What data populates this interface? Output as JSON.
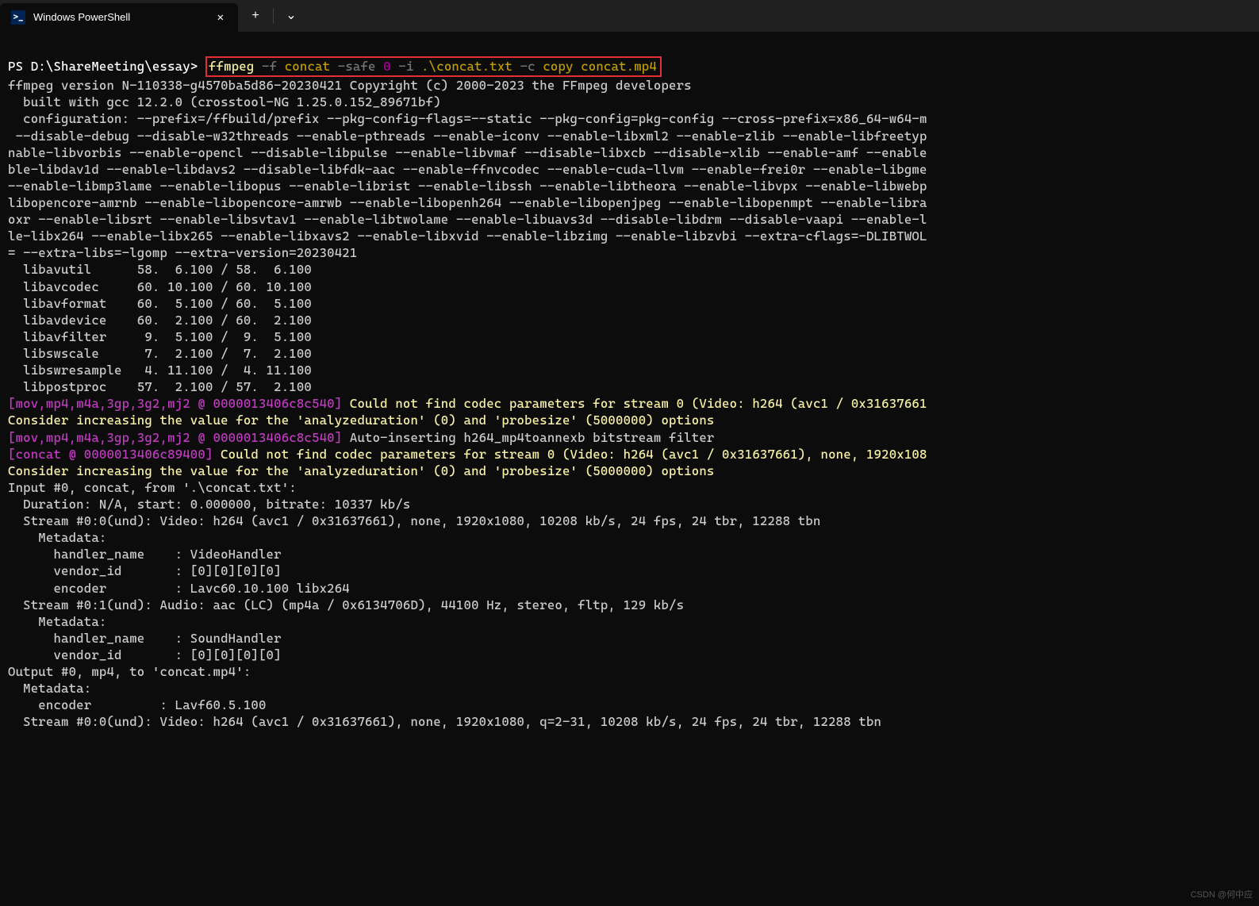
{
  "titlebar": {
    "tab_icon_glyph": ">_",
    "tab_title": "Windows PowerShell",
    "tab_close": "✕",
    "new_tab": "+",
    "dropdown": "⌄"
  },
  "prompt": {
    "ps_prefix": "PS ",
    "path": "D:\\ShareMeeting\\essay",
    "gt": "> "
  },
  "command": {
    "exe": "ffmpeg",
    "flag_f": " -f",
    "arg_concat": " concat",
    "flag_safe": " -safe",
    "arg_zero": " 0",
    "flag_i": " -i",
    "arg_input": " .\\concat.txt",
    "flag_c": " -c",
    "arg_copy": " copy",
    "arg_out": " concat.mp4"
  },
  "banner": [
    "ffmpeg version N-110338-g4570ba5d86-20230421 Copyright (c) 2000-2023 the FFmpeg developers",
    "  built with gcc 12.2.0 (crosstool-NG 1.25.0.152_89671bf)",
    "  configuration: --prefix=/ffbuild/prefix --pkg-config-flags=--static --pkg-config=pkg-config --cross-prefix=x86_64-w64-m",
    " --disable-debug --disable-w32threads --enable-pthreads --enable-iconv --enable-libxml2 --enable-zlib --enable-libfreetyp",
    "nable-libvorbis --enable-opencl --disable-libpulse --enable-libvmaf --disable-libxcb --disable-xlib --enable-amf --enable",
    "ble-libdav1d --enable-libdavs2 --disable-libfdk-aac --enable-ffnvcodec --enable-cuda-llvm --enable-frei0r --enable-libgme",
    "--enable-libmp3lame --enable-libopus --enable-librist --enable-libssh --enable-libtheora --enable-libvpx --enable-libwebp",
    "libopencore-amrnb --enable-libopencore-amrwb --enable-libopenh264 --enable-libopenjpeg --enable-libopenmpt --enable-libra",
    "oxr --enable-libsrt --enable-libsvtav1 --enable-libtwolame --enable-libuavs3d --disable-libdrm --disable-vaapi --enable-l",
    "le-libx264 --enable-libx265 --enable-libxavs2 --enable-libxvid --enable-libzimg --enable-libzvbi --extra-cflags=-DLIBTWOL",
    "= --extra-libs=-lgomp --extra-version=20230421"
  ],
  "libs": [
    "  libavutil      58.  6.100 / 58.  6.100",
    "  libavcodec     60. 10.100 / 60. 10.100",
    "  libavformat    60.  5.100 / 60.  5.100",
    "  libavdevice    60.  2.100 / 60.  2.100",
    "  libavfilter     9.  5.100 /  9.  5.100",
    "  libswscale      7.  2.100 /  7.  2.100",
    "  libswresample   4. 11.100 /  4. 11.100",
    "  libpostproc    57.  2.100 / 57.  2.100"
  ],
  "warn1": {
    "tag": "[mov,mp4,m4a,3gp,3g2,mj2 @ 0000013406c8c540] ",
    "msg": "Could not find codec parameters for stream 0 (Video: h264 (avc1 / 0x31637661",
    "cont": "Consider increasing the value for the 'analyzeduration' (0) and 'probesize' (5000000) options"
  },
  "info1": {
    "tag": "[mov,mp4,m4a,3gp,3g2,mj2 @ 0000013406c8c540] ",
    "msg": "Auto-inserting h264_mp4toannexb bitstream filter"
  },
  "warn2": {
    "tag": "[concat @ 0000013406c89400] ",
    "msg": "Could not find codec parameters for stream 0 (Video: h264 (avc1 / 0x31637661), none, 1920x108",
    "cont": "Consider increasing the value for the 'analyzeduration' (0) and 'probesize' (5000000) options"
  },
  "input_block": [
    "Input #0, concat, from '.\\concat.txt':",
    "  Duration: N/A, start: 0.000000, bitrate: 10337 kb/s",
    "  Stream #0:0(und): Video: h264 (avc1 / 0x31637661), none, 1920x1080, 10208 kb/s, 24 fps, 24 tbr, 12288 tbn",
    "    Metadata:",
    "      handler_name    : VideoHandler",
    "      vendor_id       : [0][0][0][0]",
    "      encoder         : Lavc60.10.100 libx264",
    "  Stream #0:1(und): Audio: aac (LC) (mp4a / 0x6134706D), 44100 Hz, stereo, fltp, 129 kb/s",
    "    Metadata:",
    "      handler_name    : SoundHandler",
    "      vendor_id       : [0][0][0][0]"
  ],
  "output_block": [
    "Output #0, mp4, to 'concat.mp4':",
    "  Metadata:",
    "    encoder         : Lavf60.5.100",
    "  Stream #0:0(und): Video: h264 (avc1 / 0x31637661), none, 1920x1080, q=2-31, 10208 kb/s, 24 fps, 24 tbr, 12288 tbn"
  ],
  "watermark": "CSDN @何中应"
}
